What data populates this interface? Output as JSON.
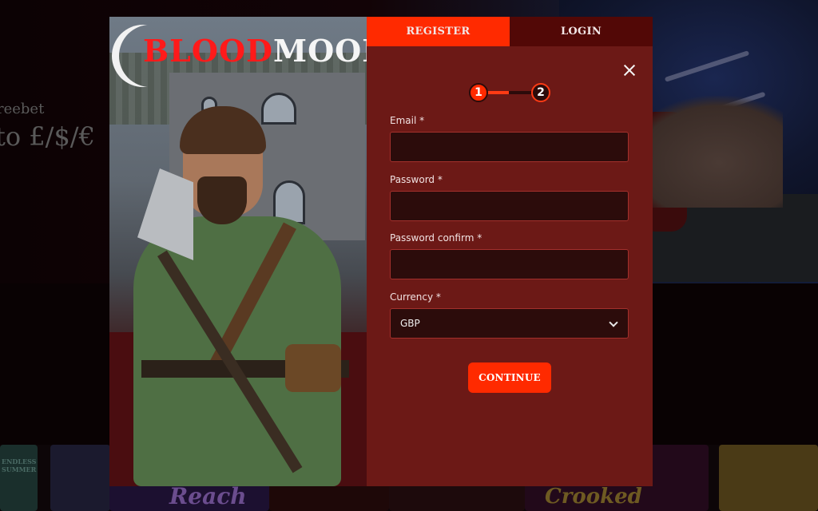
{
  "background": {
    "promo_line1": "reebet",
    "promo_line2": "to £/$/€",
    "game_tile_labels": [
      "ENDLESS SUMMER",
      "Reach",
      "Crooked"
    ]
  },
  "modal": {
    "logo": {
      "blood": "BLOOD",
      "moon": "MOON"
    },
    "tabs": [
      {
        "label": "REGISTER",
        "active": true
      },
      {
        "label": "LOGIN",
        "active": false
      }
    ],
    "close_icon": "close-icon",
    "stepper": {
      "steps": [
        "1",
        "2"
      ],
      "current_step": 1,
      "total_steps": 2
    },
    "form": {
      "email": {
        "label": "Email *",
        "value": "",
        "placeholder": ""
      },
      "password": {
        "label": "Password *",
        "value": "",
        "placeholder": ""
      },
      "password_confirm": {
        "label": "Password confirm *",
        "value": "",
        "placeholder": ""
      },
      "currency": {
        "label": "Currency *",
        "selected": "GBP"
      }
    },
    "continue_label": "CONTINUE"
  },
  "colors": {
    "accent": "#ff2a00",
    "panel": "#6c1916",
    "tab_inactive": "#520806",
    "input_bg": "#2c0c0b",
    "input_border": "#a3302c"
  }
}
